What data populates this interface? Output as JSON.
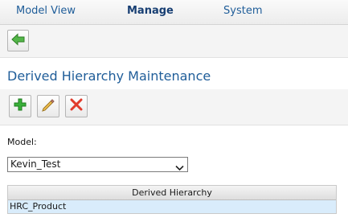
{
  "nav": {
    "tabs": [
      {
        "label": "Model View",
        "active": false
      },
      {
        "label": "Manage",
        "active": true
      },
      {
        "label": "System",
        "active": false
      }
    ]
  },
  "toolbar_top": {
    "back_icon": "back-arrow-icon"
  },
  "page": {
    "title": "Derived Hierarchy Maintenance"
  },
  "actions": {
    "add_icon": "plus-icon",
    "edit_icon": "pencil-icon",
    "delete_icon": "x-icon"
  },
  "model": {
    "label": "Model:",
    "selected": "Kevin_Test"
  },
  "grid": {
    "header": "Derived Hierarchy",
    "rows": [
      "HRC_Product"
    ]
  },
  "colors": {
    "link": "#1f5d99",
    "add": "#2fa12f",
    "delete": "#e13b2b",
    "row_highlight": "#d9ecfb"
  }
}
